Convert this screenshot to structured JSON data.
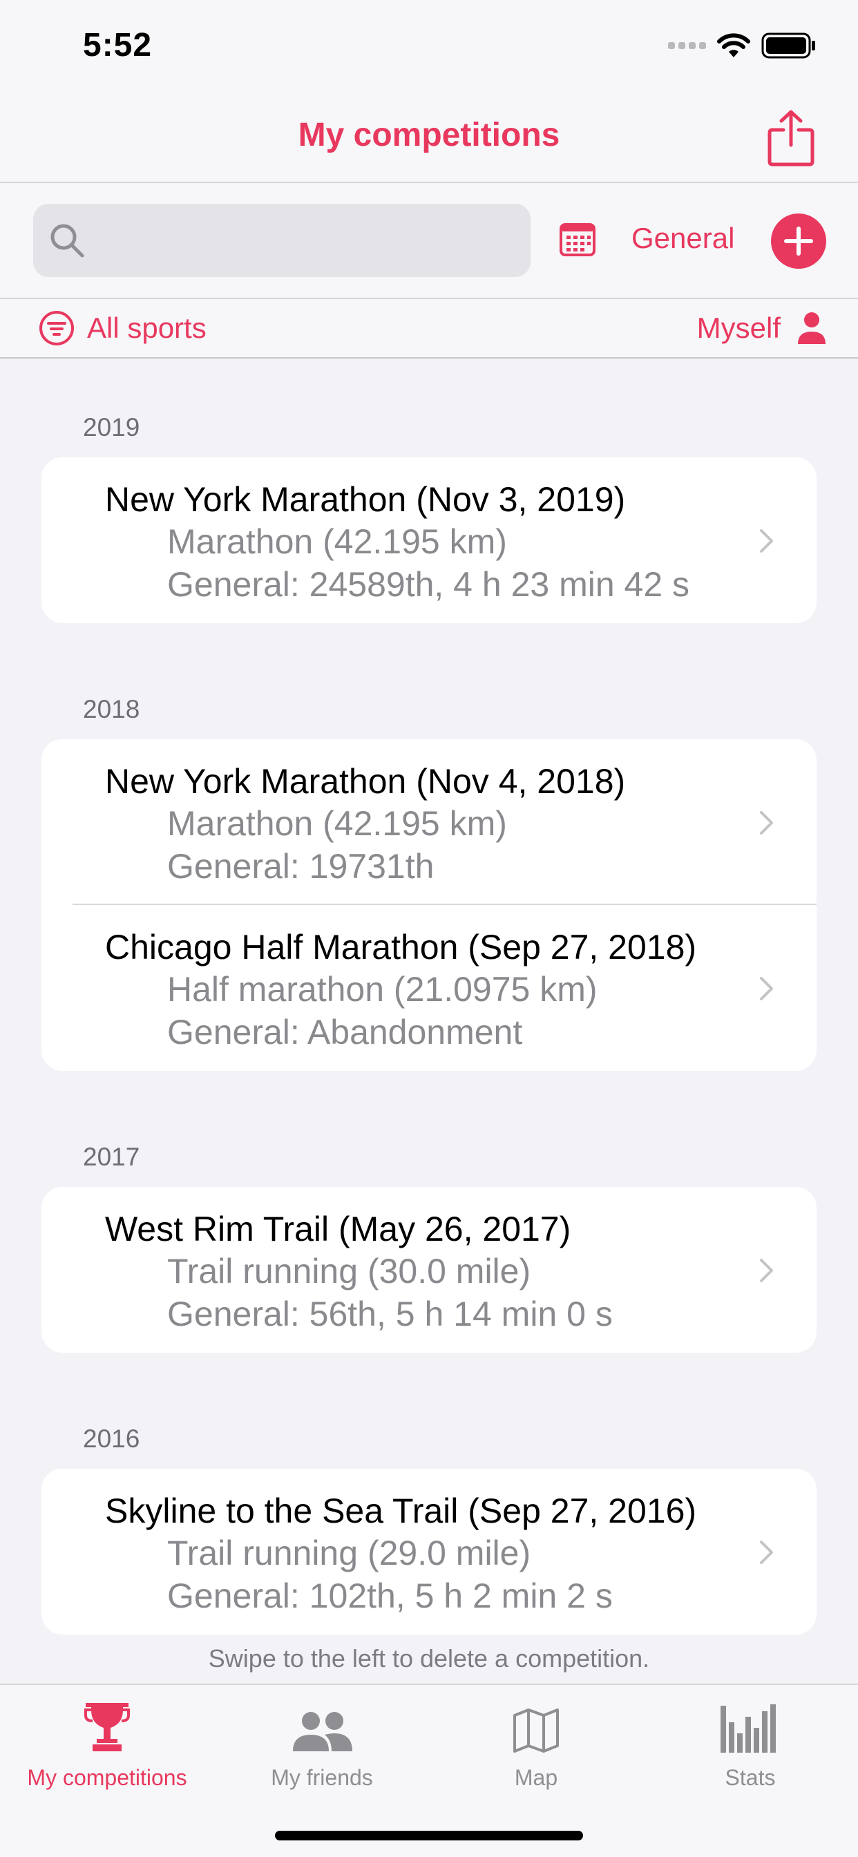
{
  "status_bar": {
    "time": "5:52"
  },
  "nav": {
    "title": "My competitions",
    "share_icon": "share-icon"
  },
  "toolbar": {
    "search_placeholder": "",
    "calendar_icon": "calendar-icon",
    "general_label": "General",
    "add_icon": "plus-icon"
  },
  "filters": {
    "sports_label": "All sports",
    "person_label": "Myself"
  },
  "sections": [
    {
      "year": "2019",
      "items": [
        {
          "title": "New York Marathon (Nov 3, 2019)",
          "distance": "Marathon (42.195 km)",
          "result": "General: 24589th, 4 h 23 min 42 s"
        }
      ]
    },
    {
      "year": "2018",
      "items": [
        {
          "title": "New York Marathon (Nov 4, 2018)",
          "distance": "Marathon (42.195 km)",
          "result": "General: 19731th"
        },
        {
          "title": "Chicago Half Marathon (Sep 27, 2018)",
          "distance": "Half marathon (21.0975 km)",
          "result": "General: Abandonment"
        }
      ]
    },
    {
      "year": "2017",
      "items": [
        {
          "title": "West Rim Trail (May 26, 2017)",
          "distance": "Trail running (30.0 mile)",
          "result": "General: 56th, 5 h 14 min 0 s"
        }
      ]
    },
    {
      "year": "2016",
      "items": [
        {
          "title": "Skyline to the Sea Trail (Sep 27, 2016)",
          "distance": "Trail running (29.0 mile)",
          "result": "General: 102th, 5 h 2 min 2 s"
        }
      ]
    }
  ],
  "footer_hint": "Swipe to the left to delete a competition.",
  "tabs": [
    {
      "label": "My competitions",
      "icon": "trophy-icon",
      "active": true
    },
    {
      "label": "My friends",
      "icon": "people-icon",
      "active": false
    },
    {
      "label": "Map",
      "icon": "map-icon",
      "active": false
    },
    {
      "label": "Stats",
      "icon": "bar-chart-icon",
      "active": false
    }
  ],
  "colors": {
    "accent": "#e8385e",
    "inactive": "#8e8e93",
    "background": "#f2f2f7"
  }
}
